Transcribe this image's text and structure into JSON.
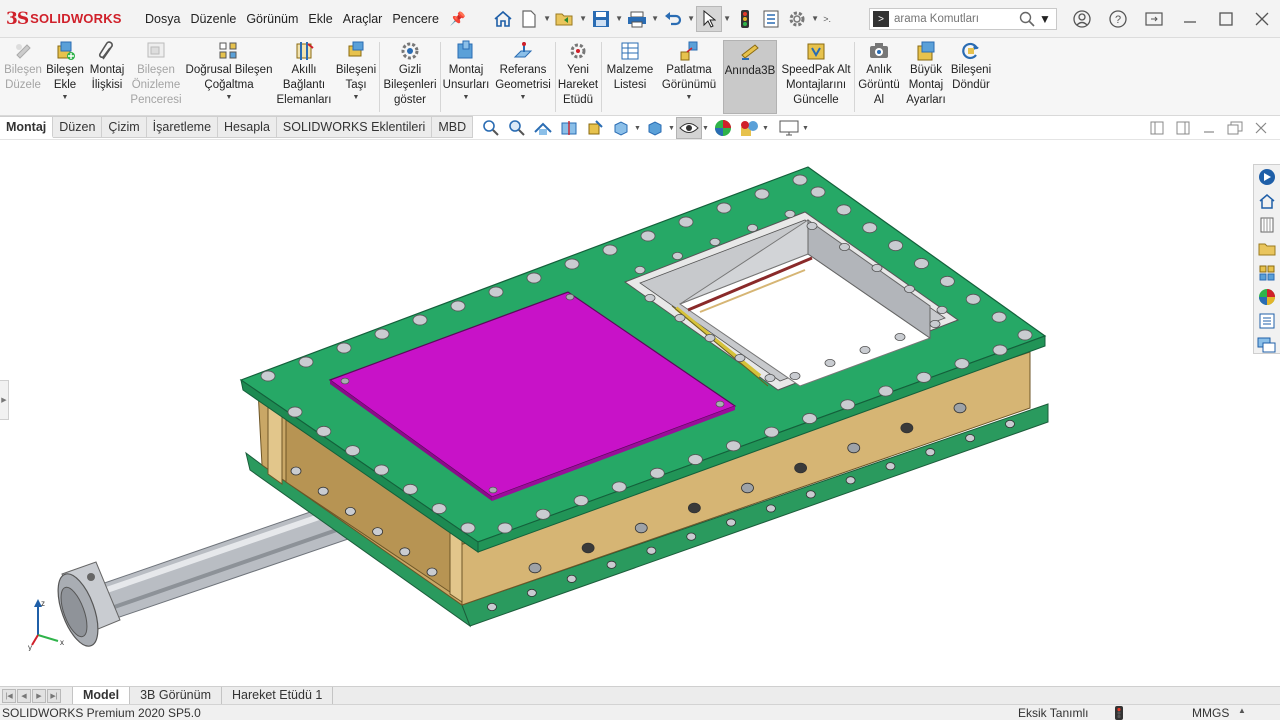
{
  "app": {
    "logo_ds": "3S",
    "logo_text": "SOLIDWORKS"
  },
  "menu": [
    "Dosya",
    "Düzenle",
    "Görünüm",
    "Ekle",
    "Araçlar",
    "Pencere"
  ],
  "search": {
    "placeholder": "arama Komutları"
  },
  "command_manager": {
    "buttons": [
      {
        "label": "Bileşen\nDüzele",
        "icon": "edit-component-icon",
        "enabled": false
      },
      {
        "label": "Bileşen\nEkle",
        "icon": "insert-component-icon",
        "enabled": true,
        "dropdown": true
      },
      {
        "label": "Montaj\nİlişkisi",
        "icon": "mate-paperclip-icon",
        "enabled": true
      },
      {
        "label": "Bileşen\nÖnizleme\nPenceresi",
        "icon": "component-preview-icon",
        "enabled": false
      },
      {
        "label": "Doğrusal Bileşen\nÇoğaltma",
        "icon": "linear-pattern-icon",
        "enabled": true,
        "dropdown": true
      },
      {
        "label": "Akıllı\nBağlantı\nElemanları",
        "icon": "smart-fasteners-icon",
        "enabled": true
      },
      {
        "label": "Bileşeni\nTaşı",
        "icon": "move-component-icon",
        "enabled": true,
        "dropdown": true
      },
      {
        "label": "Gizli\nBileşenleri\ngöster",
        "icon": "show-hidden-icon",
        "enabled": true
      },
      {
        "label": "Montaj\nUnsurları",
        "icon": "assembly-features-icon",
        "enabled": true,
        "dropdown": true
      },
      {
        "label": "Referans\nGeometrisi",
        "icon": "reference-geometry-icon",
        "enabled": true,
        "dropdown": true
      },
      {
        "label": "Yeni\nHareket\nEtüdü",
        "icon": "motion-study-icon",
        "enabled": true
      },
      {
        "label": "Malzeme\nListesi",
        "icon": "bill-of-materials-icon",
        "enabled": true
      },
      {
        "label": "Patlatma\nGörünümü",
        "icon": "exploded-view-icon",
        "enabled": true,
        "dropdown": true
      },
      {
        "label": "Anında3B",
        "icon": "instant3d-icon",
        "enabled": true,
        "active": true
      },
      {
        "label": "SpeedPak Alt\nMontajlarını\nGüncelle",
        "icon": "speedpak-icon",
        "enabled": true
      },
      {
        "label": "Anlık\nGörüntü\nAl",
        "icon": "snapshot-camera-icon",
        "enabled": true
      },
      {
        "label": "Büyük\nMontaj\nAyarları",
        "icon": "large-assembly-icon",
        "enabled": true
      },
      {
        "label": "Bileşeni\nDöndür",
        "icon": "rotate-component-icon",
        "enabled": true
      }
    ]
  },
  "tabs": [
    "Montaj",
    "Düzen",
    "Çizim",
    "İşaretleme",
    "Hesapla",
    "SOLIDWORKS Eklentileri",
    "MBD"
  ],
  "bottom_tabs": [
    "Model",
    "3B Görünüm",
    "Hareket Etüdü 1"
  ],
  "status": {
    "product": "SOLIDWORKS Premium 2020 SP5.0",
    "definition": "Eksik Tanımlı",
    "units": "MMGS",
    "units_arrow": "▲"
  },
  "triad": {
    "x": "x",
    "y": "y",
    "z": "z"
  },
  "colors": {
    "top_plate": "#26a866",
    "gate_blade": "#c812c8",
    "body": "#d6b574",
    "accent_red": "#d0202a"
  }
}
